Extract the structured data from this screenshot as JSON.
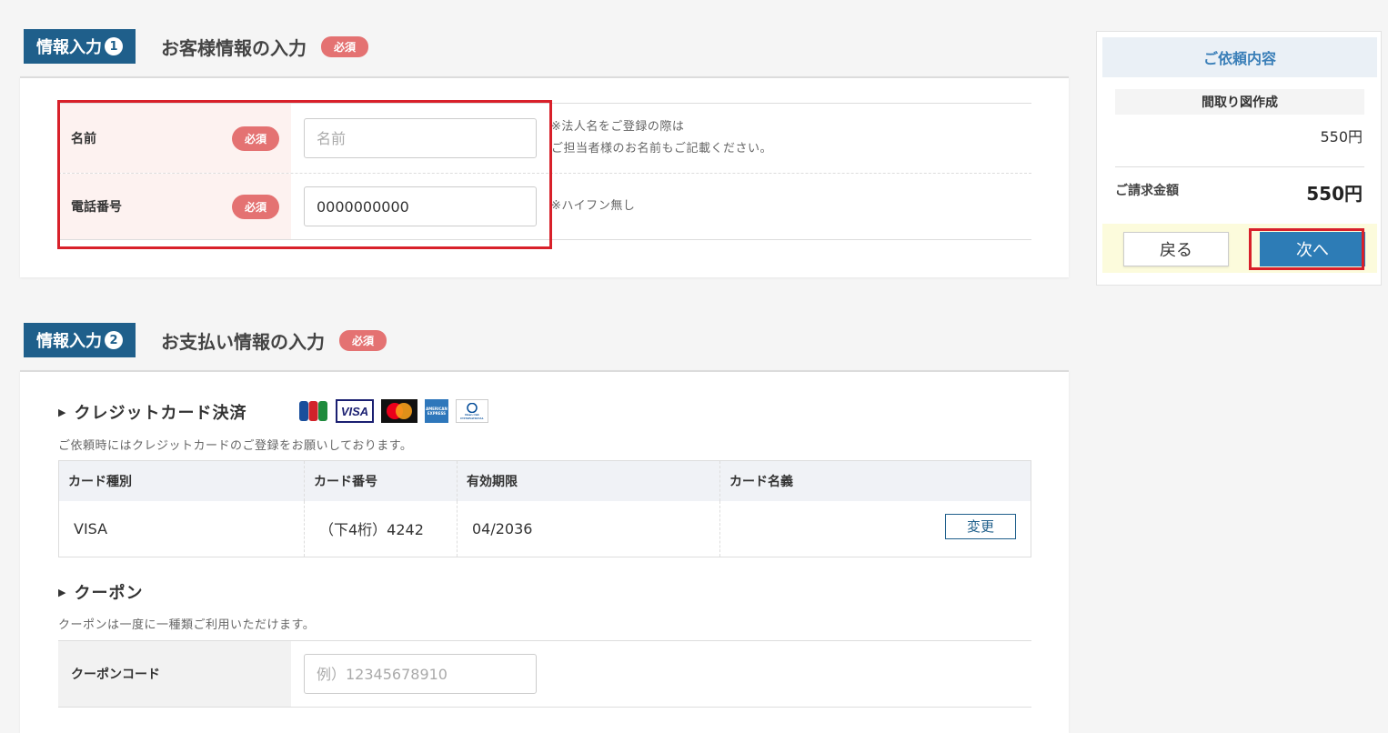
{
  "section1": {
    "tag": "情報入力",
    "num": "1",
    "title": "お客様情報の入力",
    "required": "必須",
    "rows": [
      {
        "label": "名前",
        "required": "必須",
        "placeholder": "名前",
        "value": "",
        "note_lines": [
          "※法人名をご登録の際は",
          "ご担当者様のお名前もご記載ください。"
        ]
      },
      {
        "label": "電話番号",
        "required": "必須",
        "placeholder": "",
        "value": "0000000000",
        "note_lines": [
          "※ハイフン無し"
        ]
      }
    ]
  },
  "section2": {
    "tag": "情報入力",
    "num": "2",
    "title": "お支払い情報の入力",
    "required": "必須",
    "credit": {
      "heading": "クレジットカード決済",
      "description": "ご依頼時にはクレジットカードのご登録をお願いしております。",
      "logos": [
        "jcb-logo",
        "visa-logo",
        "mastercard-logo",
        "amex-logo",
        "diners-logo"
      ],
      "logo_texts": {
        "jcb": "JCB",
        "visa": "VISA",
        "amex": "AMERICAN EXPRESS",
        "diners": "Diners Club INTERNATIONAL"
      },
      "columns": [
        "カード種別",
        "カード番号",
        "有効期限",
        "カード名義"
      ],
      "row": {
        "type": "VISA",
        "number": "（下4桁）4242",
        "expiry": "04/2036",
        "holder": ""
      },
      "change_label": "変更"
    },
    "coupon": {
      "heading": "クーポン",
      "description": "クーポンは一度に一種類ご利用いただけます。",
      "label": "クーポンコード",
      "placeholder": "例）12345678910"
    }
  },
  "sidebar": {
    "title": "ご依頼内容",
    "item": "間取り図作成",
    "item_price": "550円",
    "total_label": "ご請求金額",
    "total": "550円",
    "back_label": "戻る",
    "next_label": "次へ"
  },
  "colors": {
    "brand": "#1f5f8b",
    "required": "#e47272",
    "highlight": "#d8202a",
    "next_button": "#2d7cb6"
  }
}
